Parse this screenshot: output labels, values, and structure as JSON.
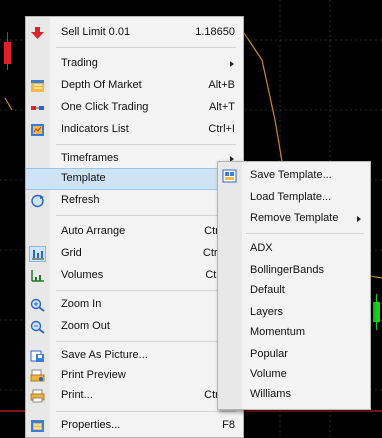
{
  "colors": {
    "chart_bg": "#000000",
    "menu_bg": "#f3f3f3",
    "highlight": "#cfe3f6",
    "bear_candle": "#e0202a",
    "bull_candle": "#19d219",
    "indicator_line": "#c8872a"
  },
  "menu": {
    "items": [
      {
        "label": "Sell Limit 0.01",
        "shortcut": "1.18650",
        "icon": "sell-arrow-icon"
      },
      {
        "label": "Trading",
        "shortcut": "",
        "icon": ""
      },
      {
        "label": "Depth Of Market",
        "shortcut": "Alt+B",
        "icon": "depth-of-market-icon"
      },
      {
        "label": "One Click Trading",
        "shortcut": "Alt+T",
        "icon": "one-click-trading-icon"
      },
      {
        "label": "Indicators List",
        "shortcut": "Ctrl+I",
        "icon": "indicators-list-icon"
      },
      {
        "label": "Timeframes",
        "shortcut": "",
        "icon": ""
      },
      {
        "label": "Template",
        "shortcut": "",
        "icon": ""
      },
      {
        "label": "Refresh",
        "shortcut": "",
        "icon": "refresh-icon"
      },
      {
        "label": "Auto Arrange",
        "shortcut": "Ctrl+A",
        "icon": ""
      },
      {
        "label": "Grid",
        "shortcut": "Ctrl+G",
        "icon": "grid-icon"
      },
      {
        "label": "Volumes",
        "shortcut": "Ctrl+L",
        "icon": "volumes-icon"
      },
      {
        "label": "Zoom In",
        "shortcut": "+",
        "icon": "zoom-in-icon"
      },
      {
        "label": "Zoom Out",
        "shortcut": "-",
        "icon": "zoom-out-icon"
      },
      {
        "label": "Save As Picture...",
        "shortcut": "",
        "icon": "save-picture-icon"
      },
      {
        "label": "Print Preview",
        "shortcut": "",
        "icon": "print-preview-icon"
      },
      {
        "label": "Print...",
        "shortcut": "Ctrl+P",
        "icon": "print-icon"
      },
      {
        "label": "Properties...",
        "shortcut": "F8",
        "icon": "properties-icon"
      }
    ]
  },
  "submenu": {
    "items": [
      {
        "label": "Save Template...",
        "icon": "save-template-icon"
      },
      {
        "label": "Load Template...",
        "icon": ""
      },
      {
        "label": "Remove Template",
        "icon": ""
      },
      {
        "label": "ADX",
        "icon": ""
      },
      {
        "label": "BollingerBands",
        "icon": ""
      },
      {
        "label": "Default",
        "icon": ""
      },
      {
        "label": "Layers",
        "icon": ""
      },
      {
        "label": "Momentum",
        "icon": ""
      },
      {
        "label": "Popular",
        "icon": ""
      },
      {
        "label": "Volume",
        "icon": ""
      },
      {
        "label": "Williams",
        "icon": ""
      }
    ]
  }
}
